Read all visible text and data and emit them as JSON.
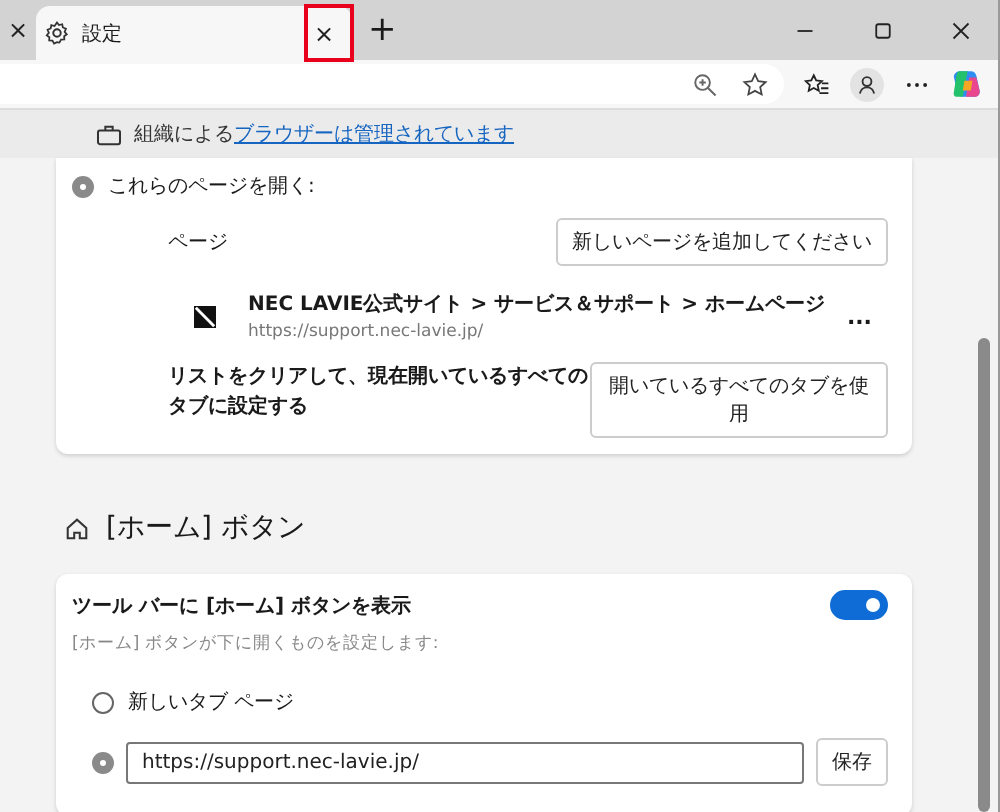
{
  "browser": {
    "prev_tab_close": "×",
    "tabs": [
      {
        "title": "設定",
        "close": "×",
        "selected": true
      }
    ],
    "new_tab": "+"
  },
  "info_bar": {
    "prefix": "組織による",
    "link": "ブラウザーは管理されています"
  },
  "startup": {
    "option": {
      "label": "これらのページを開く:",
      "selected": true
    },
    "pages_label": "ページ",
    "add_button": "新しいページを追加してください",
    "pages": [
      {
        "title": "NEC LAVIE公式サイト > サービス＆サポート > ホームページ",
        "url": "https://support.nec-lavie.jp/",
        "menu": "..."
      }
    ],
    "clear_text": "リストをクリアして、現在開いているすべてのタブに設定する",
    "use_tabs_button": "開いているすべてのタブを使用"
  },
  "home": {
    "heading": "[ホーム] ボタン",
    "toggle_label": "ツール バーに [ホーム] ボタンを表示",
    "toggle_on": true,
    "description": "[ホーム] ボタンが下に開くものを設定します:",
    "options": [
      {
        "kind": "plain",
        "label": "新しいタブ ページ",
        "selected": false
      },
      {
        "kind": "url",
        "value": "https://support.nec-lavie.jp/",
        "selected": true
      }
    ],
    "save_button": "保存"
  }
}
